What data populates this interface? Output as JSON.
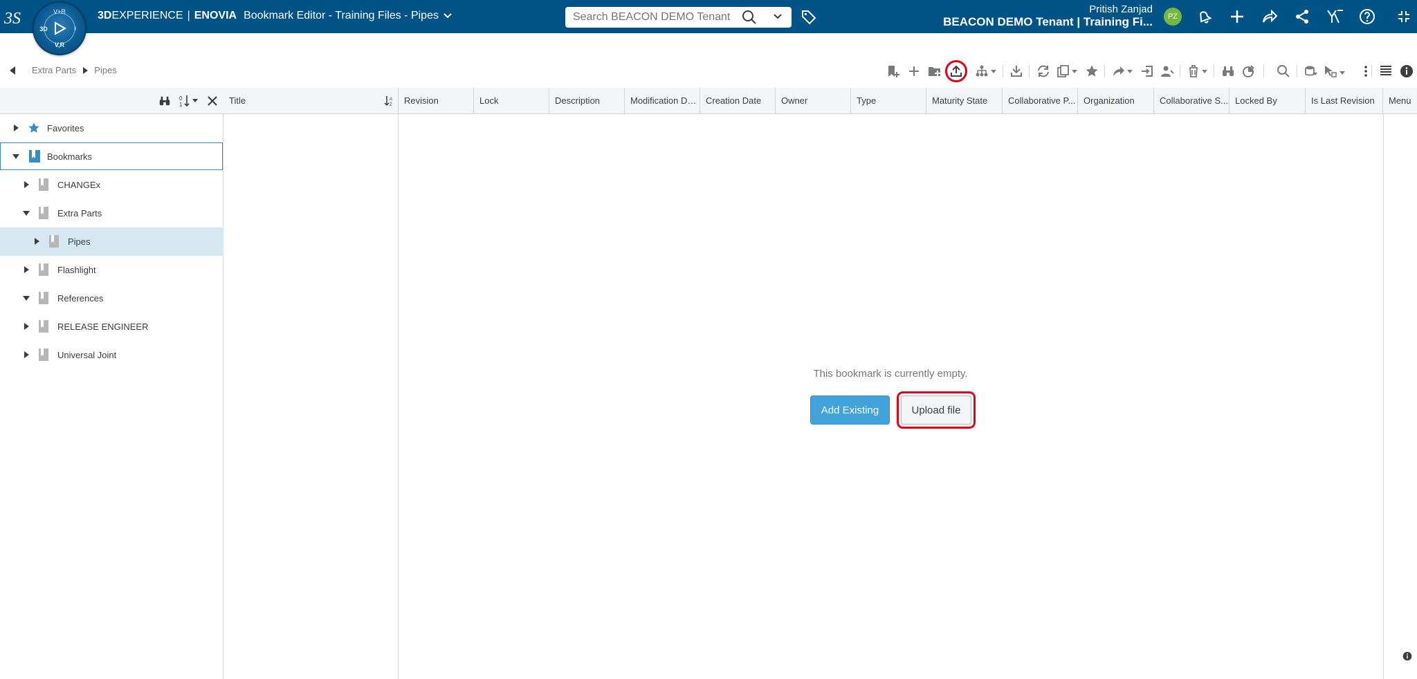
{
  "topbar": {
    "brand_bold": "3D",
    "brand_rest": "EXPERIENCE",
    "separator": "|",
    "app_name": "ENOVIA",
    "doc_title": "Bookmark Editor - Training Files - Pipes",
    "compass_top": "V+R",
    "compass_left": "3D",
    "compass_right": "i",
    "compass_bottom": "V,R",
    "search_placeholder": "Search BEACON DEMO Tenant",
    "user_name": "Pritish Zanjad",
    "tenant_label": "BEACON DEMO Tenant | Training Fi...",
    "avatar_initials": "PZ",
    "colors": {
      "bar": "#005386",
      "avatar": "#76b83f"
    }
  },
  "breadcrumb": {
    "items": [
      "Extra Parts",
      "Pipes"
    ]
  },
  "tree": {
    "items": [
      {
        "label": "Favorites"
      },
      {
        "label": "Bookmarks"
      },
      {
        "label": "CHANGEx"
      },
      {
        "label": "Extra Parts"
      },
      {
        "label": "Pipes"
      },
      {
        "label": "Flashlight"
      },
      {
        "label": "References"
      },
      {
        "label": "RELEASE ENGINEER"
      },
      {
        "label": "Universal Joint"
      }
    ]
  },
  "grid": {
    "columns": [
      "Title",
      "Revision",
      "Lock",
      "Description",
      "Modification Date",
      "Creation Date",
      "Owner",
      "Type",
      "Maturity State",
      "Collaborative P...",
      "Organization",
      "Collaborative S...",
      "Locked By",
      "Is Last Revision",
      "Menu"
    ]
  },
  "empty_state": {
    "message": "This bookmark is currently empty.",
    "add_existing_label": "Add Existing",
    "upload_label": "Upload file"
  }
}
